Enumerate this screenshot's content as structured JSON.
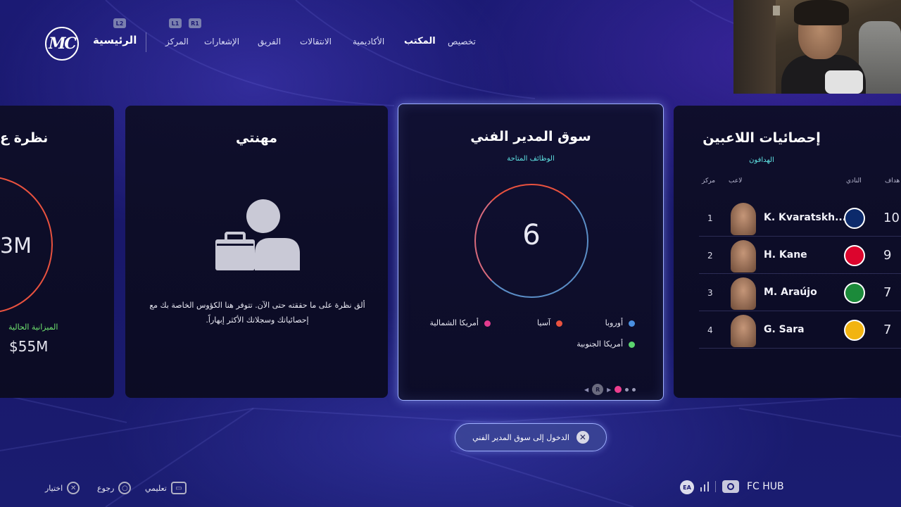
{
  "nav": {
    "logo": "MC",
    "home": "الرئيسية",
    "items": [
      "المركز",
      "الإشعارات",
      "الفريق",
      "الانتقالات",
      "الأكاديمية",
      "المكتب",
      "تخصيص"
    ],
    "active_index": 5,
    "button_hints": {
      "l2": "L2",
      "l1": "L1",
      "r1": "R1"
    }
  },
  "cards": {
    "budget": {
      "title": "نظرة ع",
      "amount_partial": "3M",
      "budget_label": "الميزانية الحالية",
      "budget_value": "$55M"
    },
    "career": {
      "title": "مهنتي",
      "description": "ألق نظرة على ما حققته حتى الآن. تتوفر هنا الكؤوس الخاصة بك مع إحصائياتك وسجلاتك الأكثر إبهاراً."
    },
    "market": {
      "title": "سوق المدير الفني",
      "subtitle": "الوظائف المتاحة",
      "jobs_count": "6",
      "legend": [
        {
          "label": "أوروبا",
          "color": "#4a90e2"
        },
        {
          "label": "آسيا",
          "color": "#e9523f"
        },
        {
          "label": "أمريكا الشمالية",
          "color": "#e23b8f"
        },
        {
          "label": "أمريكا الجنوبية",
          "color": "#5bd46e"
        }
      ],
      "pager": {
        "button": "R"
      }
    },
    "stats": {
      "title": "إحصائيات اللاعبين",
      "subtitle": "الهدافون",
      "headers": {
        "rank": "مركز",
        "player": "لاعب",
        "club": "النادي",
        "goals": "هداف"
      },
      "rows": [
        {
          "rank": "1",
          "name": "K. Kvaratskh...",
          "goals": "10",
          "crest_color": "#0c2a6b"
        },
        {
          "rank": "2",
          "name": "H. Kane",
          "goals": "9",
          "crest_color": "#dc052d"
        },
        {
          "rank": "3",
          "name": "M. Araújo",
          "goals": "7",
          "crest_color": "#1b8a3a"
        },
        {
          "rank": "4",
          "name": "G. Sara",
          "goals": "7",
          "crest_color": "#f2b411"
        }
      ]
    }
  },
  "enter_button": {
    "label": "الدخول إلى سوق المدير الفني",
    "key": "✕"
  },
  "footer": {
    "select": "اختيار",
    "back": "رجوع",
    "tutorial": "تعليمي",
    "ea": "EA",
    "fc_hub": "FC HUB"
  }
}
